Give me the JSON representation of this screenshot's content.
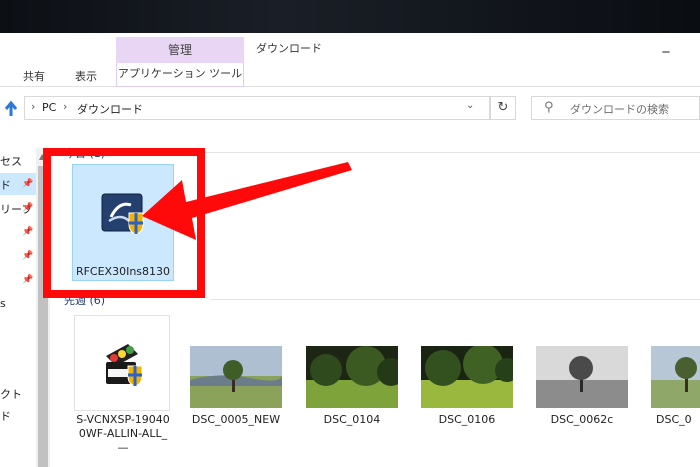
{
  "window": {
    "title": "ダウンロード",
    "minimize": "_"
  },
  "ribbon": {
    "context_header": "管理",
    "context_tab": "アプリケーション ツール",
    "tabs": [
      "共有",
      "表示"
    ]
  },
  "address": {
    "crumbs": [
      "PC",
      "ダウンロード"
    ],
    "separator": "›",
    "search_placeholder": "ダウンロードの検索"
  },
  "nav": {
    "items": [
      {
        "label": "セス",
        "pinned": false
      },
      {
        "label": "ド",
        "pinned": true
      },
      {
        "label": "リーフ",
        "pinned": true
      },
      {
        "label": "",
        "pinned": true
      },
      {
        "label": "",
        "pinned": true
      },
      {
        "label": "s",
        "pinned": true
      },
      {
        "label": "クト",
        "pinned": false
      },
      {
        "label": "ド",
        "pinned": false
      },
      {
        "label": "",
        "pinned": false
      }
    ]
  },
  "groups": [
    {
      "header": "今日 (1)"
    },
    {
      "header": "先週 (6)"
    }
  ],
  "files_today": [
    {
      "name": "RFCEX30Ins8130",
      "icon": "installer-shield-icon"
    }
  ],
  "files_last_week": [
    {
      "name_lines": [
        "S-VCNXSP-19040",
        "0WF-ALLIN-ALL_",
        "—"
      ],
      "icon": "nikon-installer-icon"
    },
    {
      "name": "DSC_0005_NEW"
    },
    {
      "name": "DSC_0104"
    },
    {
      "name": "DSC_0106"
    },
    {
      "name": "DSC_0062c"
    },
    {
      "name": "DSC_0"
    }
  ],
  "colors": {
    "highlight": "#ff0a0a",
    "selection": "#cce8ff",
    "context_tab": "#e8d6f4"
  }
}
